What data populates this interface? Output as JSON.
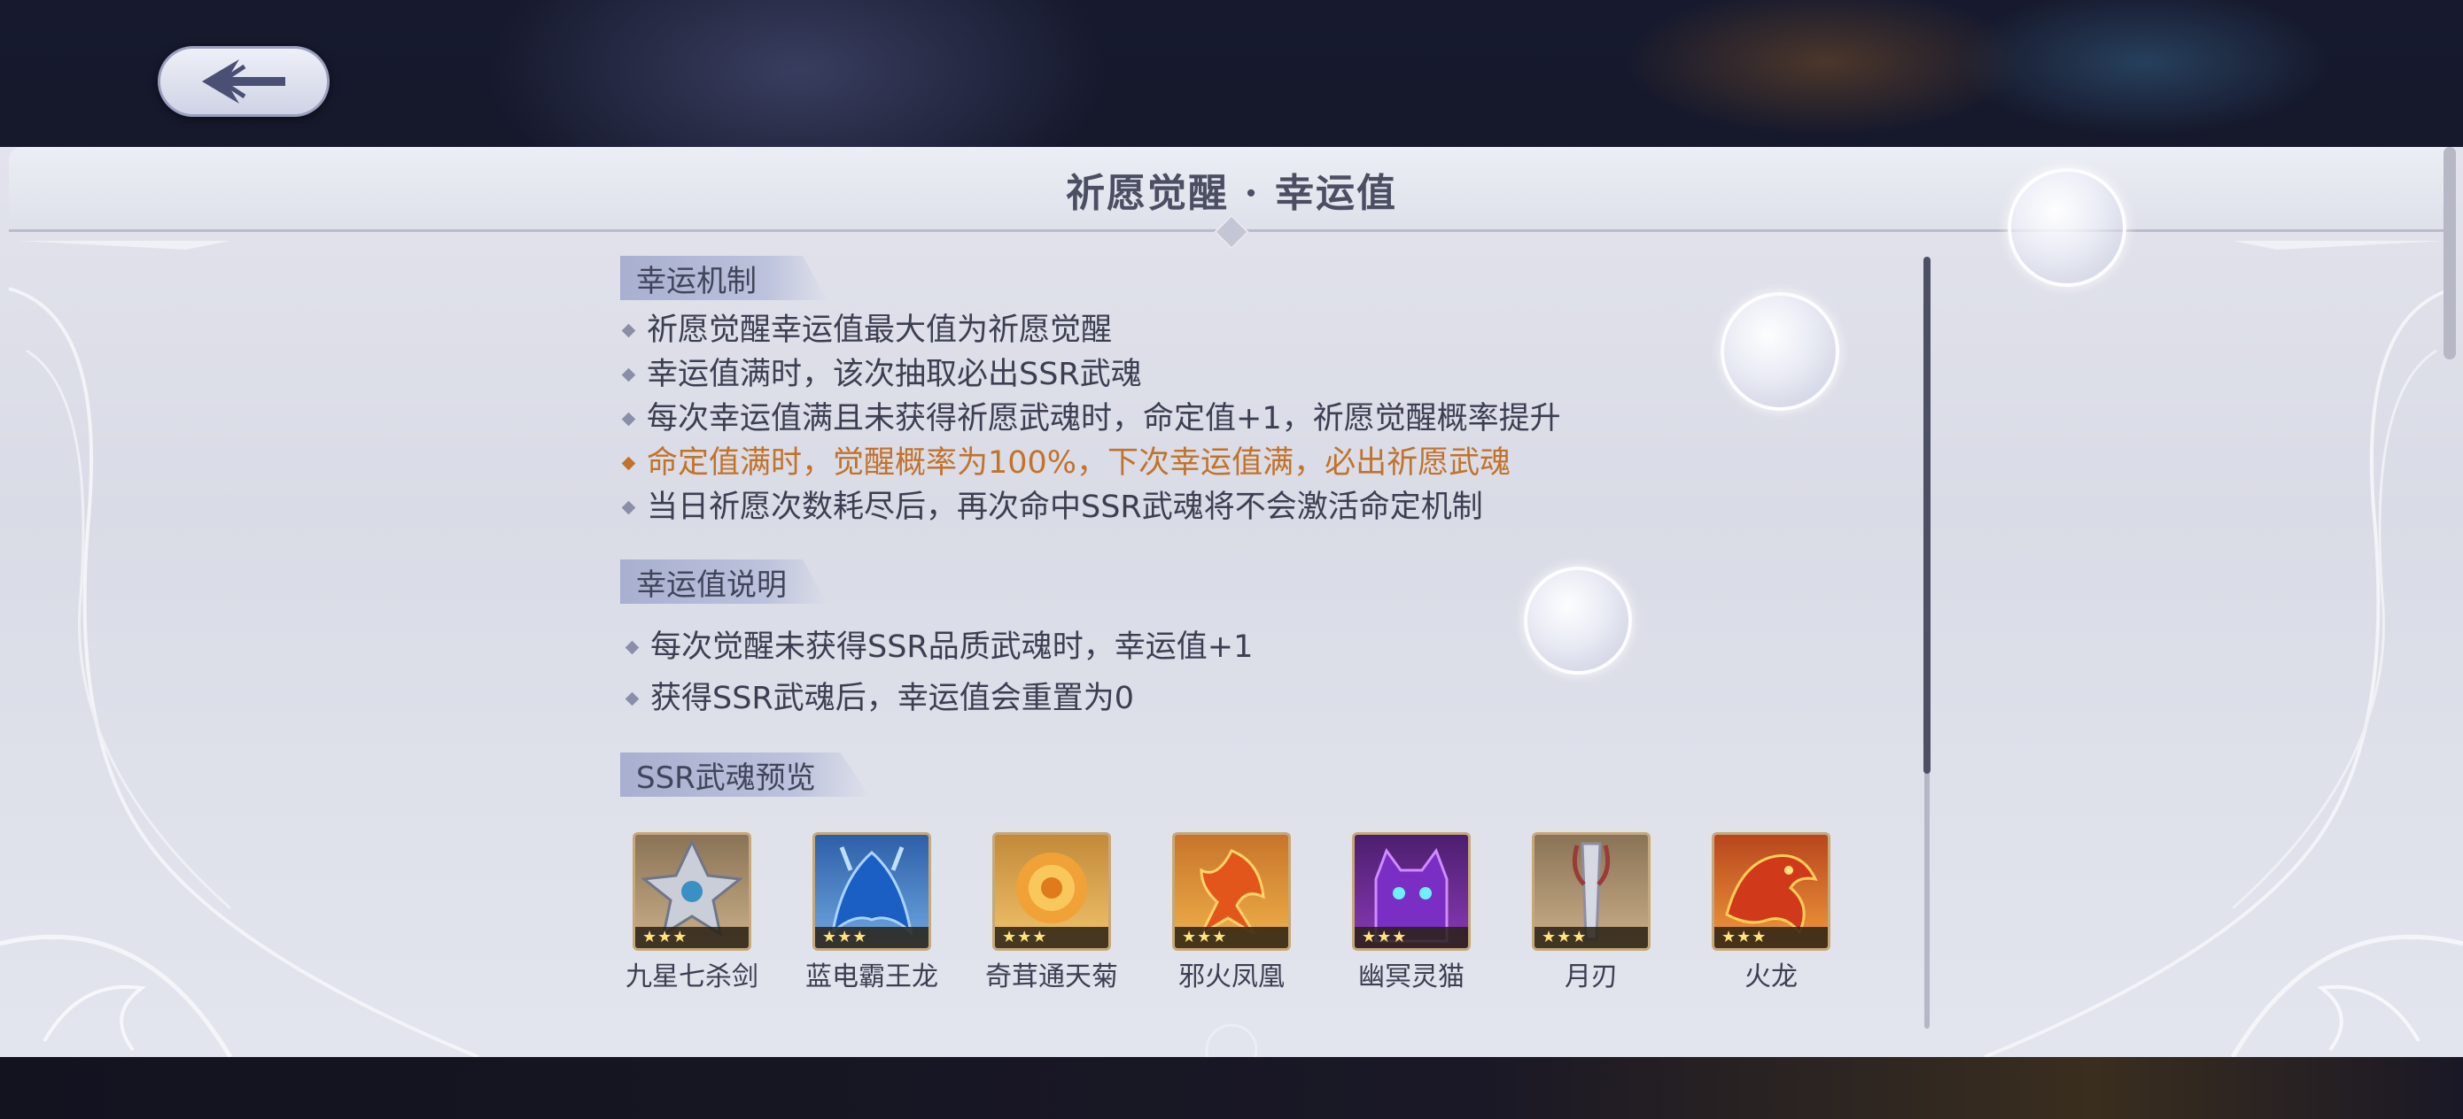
{
  "header": {
    "back_icon": "back-arrow-icon"
  },
  "panel": {
    "title": "祈愿觉醒 · 幸运值"
  },
  "sections": {
    "mechanism": {
      "title": "幸运机制",
      "items": [
        "祈愿觉醒幸运值最大值为祈愿觉醒",
        "幸运值满时，该次抽取必出SSR武魂",
        "每次幸运值满且未获得祈愿武魂时，命定值+1，祈愿觉醒概率提升",
        "命定值满时，觉醒概率为100%，下次幸运值满，必出祈愿武魂",
        "当日祈愿次数耗尽后，再次命中SSR武魂将不会激活命定机制"
      ],
      "highlight_color": "#c2732a"
    },
    "explanation": {
      "title": "幸运值说明",
      "items": [
        "每次觉醒未获得SSR品质武魂时，幸运值+1",
        "获得SSR武魂后，幸运值会重置为0"
      ]
    },
    "preview": {
      "title": "SSR武魂预览",
      "cards": [
        {
          "name": "九星七杀剑",
          "stars": "★★★",
          "icon": "sword-spirit-icon"
        },
        {
          "name": "蓝电霸王龙",
          "stars": "★★★",
          "icon": "blue-dragon-icon"
        },
        {
          "name": "奇茸通天菊",
          "stars": "★★★",
          "icon": "chrysanthemum-icon"
        },
        {
          "name": "邪火凤凰",
          "stars": "★★★",
          "icon": "phoenix-icon"
        },
        {
          "name": "幽冥灵猫",
          "stars": "★★★",
          "icon": "spirit-cat-icon"
        },
        {
          "name": "月刃",
          "stars": "★★★",
          "icon": "moon-blade-icon"
        },
        {
          "name": "火龙",
          "stars": "★★★",
          "icon": "fire-dragon-icon"
        }
      ]
    }
  },
  "colors": {
    "text": "#3c3f52",
    "accent_orange": "#c2732a",
    "panel_bg": "#dcdee8"
  }
}
